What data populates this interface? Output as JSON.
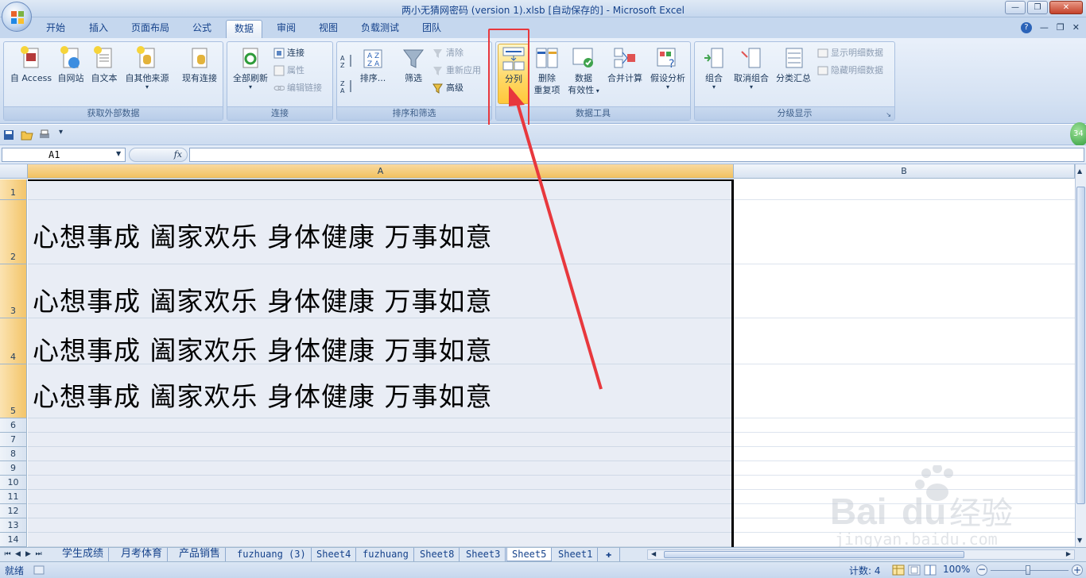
{
  "window": {
    "title": "两小无猜网密码 (version 1).xlsb [自动保存的] - Microsoft Excel",
    "minimize_glyph": "—",
    "restore_glyph": "❐",
    "close_glyph": "✕"
  },
  "tabs": [
    {
      "label": "开始"
    },
    {
      "label": "插入"
    },
    {
      "label": "页面布局"
    },
    {
      "label": "公式"
    },
    {
      "label": "数据",
      "active": true
    },
    {
      "label": "审阅"
    },
    {
      "label": "视图"
    },
    {
      "label": "负载测试"
    },
    {
      "label": "团队"
    }
  ],
  "ribbon": {
    "groups": {
      "external": {
        "label": "获取外部数据"
      },
      "connections": {
        "label": "连接"
      },
      "sort": {
        "label": "排序和筛选"
      },
      "tools": {
        "label": "数据工具"
      },
      "outline": {
        "label": "分级显示"
      }
    },
    "buttons": {
      "from_access": "自 Access",
      "from_web": "自网站",
      "from_text": "自文本",
      "from_other": "自其他来源",
      "existing_conn": "现有连接",
      "refresh_all": "全部刷新",
      "connections": "连接",
      "properties": "属性",
      "edit_links": "编辑链接",
      "sort": "排序...",
      "filter": "筛选",
      "clear": "清除",
      "reapply": "重新应用",
      "advanced": "高级",
      "text_to_columns": "分列",
      "remove_dup_1": "删除",
      "remove_dup_2": "重复项",
      "validation_1": "数据",
      "validation_2": "有效性",
      "consolidate": "合并计算",
      "what_if": "假设分析",
      "group": "组合",
      "ungroup": "取消组合",
      "subtotal": "分类汇总",
      "show_detail": "显示明细数据",
      "hide_detail": "隐藏明细数据"
    }
  },
  "formula_bar": {
    "name_box": "A1",
    "fx": "fx",
    "content": ""
  },
  "sheet": {
    "columns": [
      {
        "label": "A"
      },
      {
        "label": "B"
      }
    ],
    "rows": [
      {
        "num": "1",
        "text": ""
      },
      {
        "num": "2",
        "text": "心想事成 阖家欢乐 身体健康 万事如意"
      },
      {
        "num": "3",
        "text": "心想事成 阖家欢乐 身体健康 万事如意"
      },
      {
        "num": "4",
        "text": "心想事成 阖家欢乐 身体健康 万事如意"
      },
      {
        "num": "5",
        "text": "心想事成 阖家欢乐 身体健康 万事如意"
      },
      {
        "num": "6",
        "text": ""
      },
      {
        "num": "7",
        "text": ""
      },
      {
        "num": "8",
        "text": ""
      },
      {
        "num": "9",
        "text": ""
      },
      {
        "num": "10",
        "text": ""
      },
      {
        "num": "11",
        "text": ""
      },
      {
        "num": "12",
        "text": ""
      },
      {
        "num": "13",
        "text": ""
      },
      {
        "num": "14",
        "text": ""
      }
    ]
  },
  "sheet_tabs": [
    {
      "label": "学生成绩"
    },
    {
      "label": "月考体育"
    },
    {
      "label": "产品销售"
    },
    {
      "label": "fuzhuang (3)"
    },
    {
      "label": "Sheet4"
    },
    {
      "label": "fuzhuang"
    },
    {
      "label": "Sheet8"
    },
    {
      "label": "Sheet3"
    },
    {
      "label": "Sheet5",
      "active": true
    },
    {
      "label": "Sheet1"
    }
  ],
  "status": {
    "ready": "就绪",
    "count": "计数: 4",
    "zoom": "100%"
  },
  "badge": "34",
  "colors": {
    "annotation_red": "#e8383d",
    "highlight_button": "#ffd763",
    "selected_header": "#f1c15f"
  },
  "watermark": {
    "brand": "Baidu经验",
    "url": "jingyan.baidu.com"
  }
}
